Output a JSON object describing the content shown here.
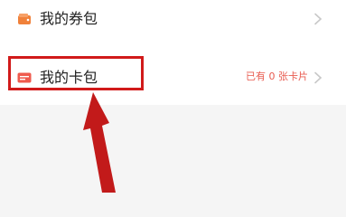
{
  "rows": [
    {
      "label": "我的券包",
      "icon": "wallet-icon",
      "icon_color": "#f0813a"
    },
    {
      "label": "我的卡包",
      "value": "已有 0 张卡片",
      "icon": "card-icon",
      "icon_color": "#ef5b4e"
    }
  ],
  "annotation": {
    "highlight_color": "#d11a1a",
    "arrow_color": "#c21a1a"
  },
  "colors": {
    "accent": "#e85a4f",
    "background": "#f5f5f5"
  }
}
